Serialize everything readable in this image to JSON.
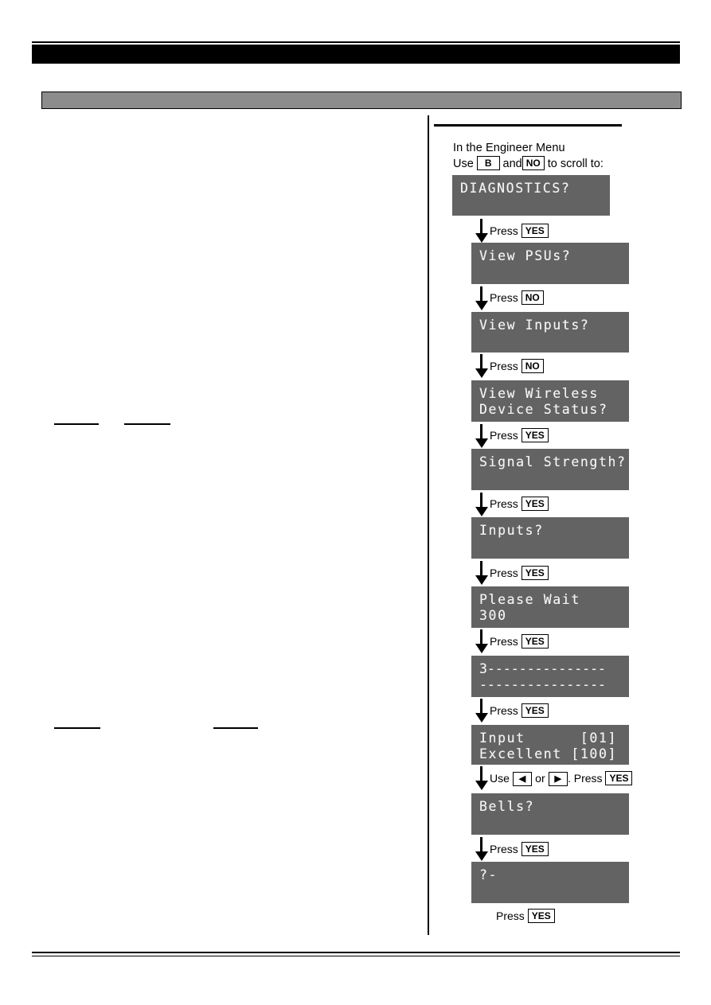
{
  "document": {
    "header_bar_label": "",
    "sub_bar_label": "",
    "footer_rule": ""
  },
  "flow": {
    "intro_line1": "In the Engineer Menu",
    "intro_line2_prefix": "Use",
    "intro_line2_key1": "B",
    "intro_line2_mid": "and",
    "intro_line2_key2": "NO",
    "intro_line2_suffix": "to scroll to:",
    "steps": [
      {
        "id": "diagnostics",
        "lcd_line1": "DIAGNOSTICS?",
        "lcd_line2": "",
        "caption_prefix": "Press",
        "caption_key": "YES",
        "caption_suffix": ""
      },
      {
        "id": "view-psus",
        "lcd_line1": "View PSUs?",
        "lcd_line2": "",
        "caption_prefix": "Press",
        "caption_key": "NO",
        "caption_suffix": ""
      },
      {
        "id": "view-inputs",
        "lcd_line1": "View Inputs?",
        "lcd_line2": "",
        "caption_prefix": "Press",
        "caption_key": "NO",
        "caption_suffix": ""
      },
      {
        "id": "view-wireless-device-status",
        "lcd_line1": "View Wireless",
        "lcd_line2": "Device Status?",
        "caption_prefix": "Press",
        "caption_key": "YES",
        "caption_suffix": ""
      },
      {
        "id": "signal-strength",
        "lcd_line1": "Signal Strength?",
        "lcd_line2": "",
        "caption_prefix": "Press",
        "caption_key": "YES",
        "caption_suffix": ""
      },
      {
        "id": "inputs",
        "lcd_line1": "Inputs?",
        "lcd_line2": "",
        "caption_prefix": "Press",
        "caption_key": "YES",
        "caption_suffix": ""
      },
      {
        "id": "please-wait",
        "lcd_line1": "Please Wait",
        "lcd_line2": "300",
        "caption_prefix": "Press",
        "caption_key": "YES",
        "caption_suffix": ""
      },
      {
        "id": "signal-bargraph",
        "lcd_line1": "3---------------",
        "lcd_line2": "----------------",
        "caption_prefix": "Press",
        "caption_key": "YES",
        "caption_suffix": ""
      },
      {
        "id": "input-excellent",
        "lcd_line1": "Input      [01]",
        "lcd_line2": "Excellent [100]",
        "caption_prefix": "Use",
        "caption_key_left": "◀",
        "caption_mid": "or",
        "caption_key_right": "▶",
        "caption_tail": ". Press",
        "caption_key": "YES",
        "caption_suffix": ""
      },
      {
        "id": "bells",
        "lcd_line1": "Bells?",
        "lcd_line2": "",
        "caption_prefix": "Press",
        "caption_key": "YES",
        "caption_suffix": ""
      },
      {
        "id": "question-dash",
        "lcd_line1": "?-",
        "lcd_line2": "",
        "caption_prefix": "Press",
        "caption_key": "YES",
        "caption_suffix": ""
      }
    ]
  },
  "colors": {
    "lcd_background": "#636363",
    "lcd_text": "#f2f2f2",
    "header_bar": "#000000",
    "sub_bar": "#8c8c8c",
    "rule": "#000000"
  }
}
